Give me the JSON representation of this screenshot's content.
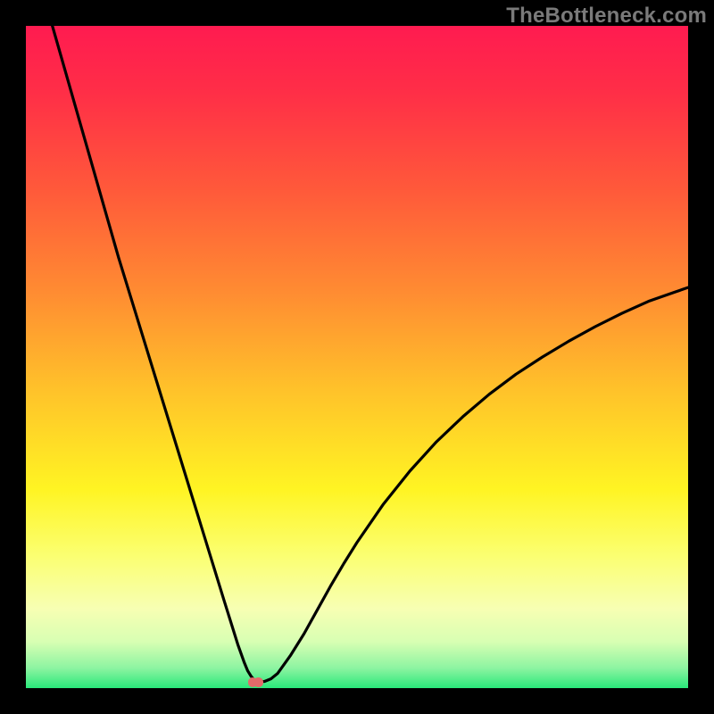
{
  "watermark": "TheBottleneck.com",
  "chart_data": {
    "type": "line",
    "title": "",
    "xlabel": "",
    "ylabel": "",
    "xlim": [
      0,
      100
    ],
    "ylim": [
      0,
      100
    ],
    "grid": false,
    "background_gradient": {
      "stops": [
        {
          "pos": 0.0,
          "color": "#ff1b50"
        },
        {
          "pos": 0.1,
          "color": "#ff2e47"
        },
        {
          "pos": 0.25,
          "color": "#ff5a3a"
        },
        {
          "pos": 0.4,
          "color": "#ff8b32"
        },
        {
          "pos": 0.55,
          "color": "#ffc22a"
        },
        {
          "pos": 0.7,
          "color": "#fff423"
        },
        {
          "pos": 0.8,
          "color": "#fbff71"
        },
        {
          "pos": 0.88,
          "color": "#f7ffb3"
        },
        {
          "pos": 0.93,
          "color": "#d8ffb3"
        },
        {
          "pos": 0.97,
          "color": "#8cf4a1"
        },
        {
          "pos": 1.0,
          "color": "#29e87a"
        }
      ]
    },
    "series": [
      {
        "name": "curve",
        "x": [
          4.0,
          6.0,
          8.0,
          10.0,
          12.0,
          14.0,
          16.0,
          18.0,
          20.0,
          22.0,
          24.0,
          26.0,
          28.0,
          30.0,
          31.0,
          32.0,
          33.0,
          33.5,
          34.0,
          34.5,
          35.0,
          36.0,
          37.0,
          38.0,
          40.0,
          42.0,
          44.0,
          46.0,
          48.0,
          50.0,
          54.0,
          58.0,
          62.0,
          66.0,
          70.0,
          74.0,
          78.0,
          82.0,
          86.0,
          90.0,
          94.0,
          98.0,
          100.0
        ],
        "y": [
          100.0,
          93.0,
          86.0,
          79.0,
          72.0,
          65.0,
          58.5,
          52.0,
          45.5,
          39.0,
          32.5,
          26.0,
          19.5,
          13.0,
          9.8,
          6.6,
          3.8,
          2.6,
          1.8,
          1.2,
          1.0,
          1.0,
          1.4,
          2.2,
          5.0,
          8.2,
          11.8,
          15.4,
          18.8,
          22.0,
          27.8,
          32.8,
          37.2,
          41.0,
          44.4,
          47.4,
          50.0,
          52.4,
          54.6,
          56.6,
          58.4,
          59.8,
          60.5
        ]
      }
    ],
    "markers": [
      {
        "name": "highlight-a",
        "x": 34.2,
        "y": 0.9,
        "r": 0.7,
        "color": "#e46a6a"
      },
      {
        "name": "highlight-b",
        "x": 35.1,
        "y": 0.9,
        "r": 0.7,
        "color": "#e46a6a"
      }
    ]
  }
}
